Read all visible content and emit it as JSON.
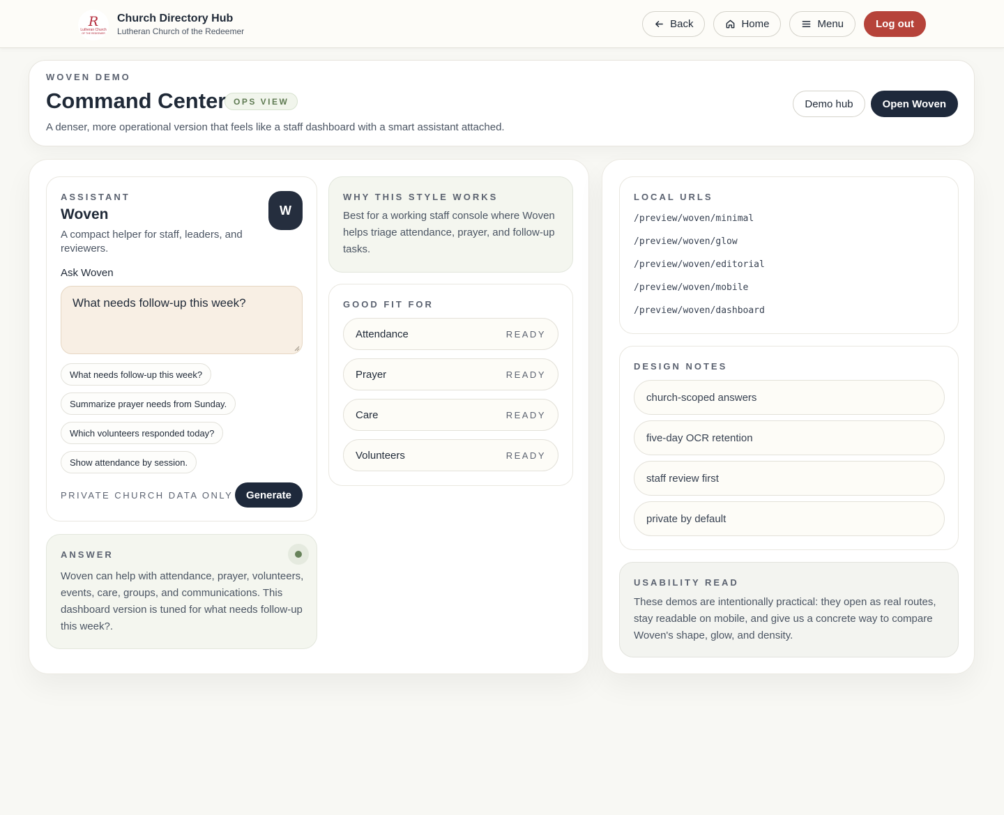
{
  "topbar": {
    "title": "Church Directory Hub",
    "subtitle": "Lutheran Church of the Redeemer",
    "logo_letter": "R",
    "logo_line1": "Lutheran Church",
    "logo_line2": "OF THE REDEEMER",
    "nav": {
      "back": "Back",
      "home": "Home",
      "menu": "Menu",
      "logout": "Log out"
    }
  },
  "hero": {
    "eyebrow": "WOVEN DEMO",
    "title": "Command Center",
    "badge": "OPS VIEW",
    "description": "A denser, more operational version that feels like a staff dashboard with a smart assistant attached.",
    "demo_hub": "Demo hub",
    "open_woven": "Open Woven"
  },
  "assistant": {
    "eyebrow": "ASSISTANT",
    "title": "Woven",
    "description": "A compact helper for staff, leaders, and reviewers.",
    "avatar": "W",
    "ask_label": "Ask Woven",
    "ask_value": "What needs follow-up this week?",
    "suggestions": [
      "What needs follow-up this week?",
      "Summarize prayer needs from Sunday.",
      "Which volunteers responded today?",
      "Show attendance by session."
    ],
    "footnote": "PRIVATE CHURCH DATA ONLY",
    "generate": "Generate"
  },
  "answer": {
    "eyebrow": "ANSWER",
    "text": "Woven can help with attendance, prayer, volunteers, events, care, groups, and communications. This dashboard version is tuned for what needs follow-up this week?."
  },
  "why": {
    "eyebrow": "WHY THIS STYLE WORKS",
    "text": "Best for a working staff console where Woven helps triage attendance, prayer, and follow-up tasks."
  },
  "good_fit": {
    "eyebrow": "GOOD FIT FOR",
    "items": [
      {
        "name": "Attendance",
        "status": "READY"
      },
      {
        "name": "Prayer",
        "status": "READY"
      },
      {
        "name": "Care",
        "status": "READY"
      },
      {
        "name": "Volunteers",
        "status": "READY"
      }
    ]
  },
  "local_urls": {
    "eyebrow": "LOCAL URLS",
    "urls": [
      "/preview/woven/minimal",
      "/preview/woven/glow",
      "/preview/woven/editorial",
      "/preview/woven/mobile",
      "/preview/woven/dashboard"
    ]
  },
  "design_notes": {
    "eyebrow": "DESIGN NOTES",
    "notes": [
      "church-scoped answers",
      "five-day OCR retention",
      "staff review first",
      "private by default"
    ]
  },
  "usability": {
    "eyebrow": "USABILITY READ",
    "text": "These demos are intentionally practical: they open as real routes, stay readable on mobile, and give us a concrete way to compare Woven's shape, glow, and density."
  },
  "colors": {
    "accent_dark": "#1e293b",
    "logout": "#b6433a",
    "ops_badge": "#5e7a52",
    "status_dot": "#67825a"
  }
}
